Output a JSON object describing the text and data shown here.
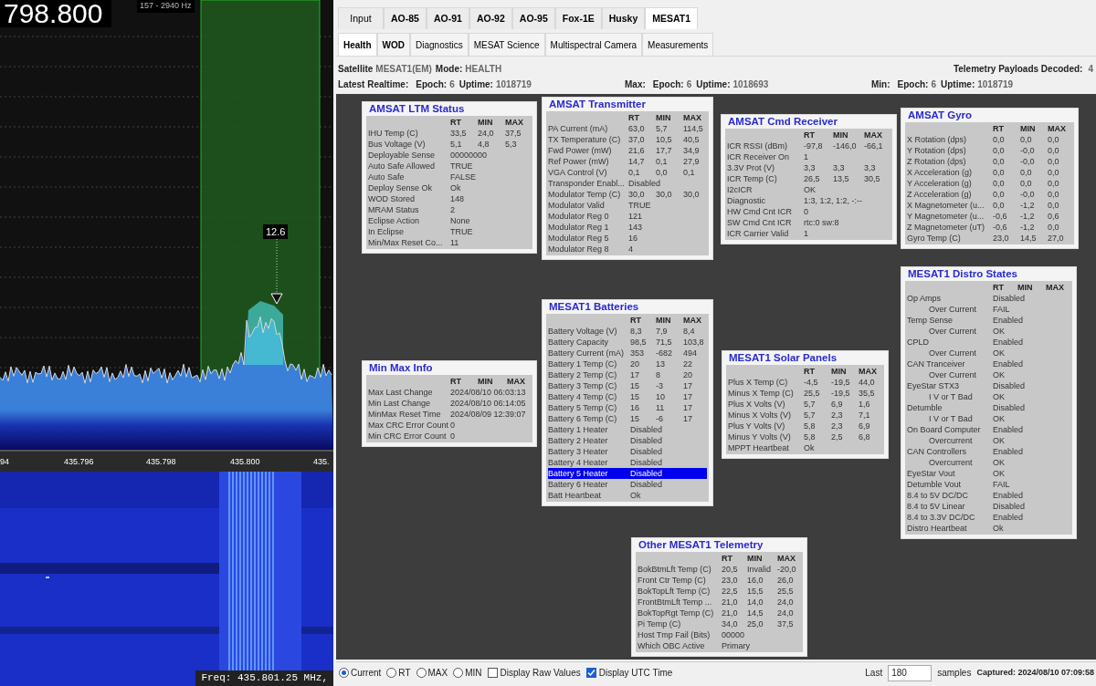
{
  "spectrum": {
    "frequency": "798.800",
    "bandwidth": "157 - 2940 Hz",
    "marker": "12.6",
    "axis_labels": [
      "94",
      "435.796",
      "435.798",
      "435.800",
      "435."
    ]
  },
  "waterfall": {
    "readout": "Freq: 435.801.25 MHz,"
  },
  "satellite_tabs": [
    {
      "label": "Input",
      "selected": false
    },
    {
      "label": "AO-85",
      "selected": false
    },
    {
      "label": "AO-91",
      "selected": false
    },
    {
      "label": "AO-92",
      "selected": false
    },
    {
      "label": "AO-95",
      "selected": false
    },
    {
      "label": "Fox-1E",
      "selected": false
    },
    {
      "label": "Husky",
      "selected": false
    },
    {
      "label": "MESAT1",
      "selected": true
    }
  ],
  "view_tabs": [
    {
      "label": "Health",
      "selected": true
    },
    {
      "label": "WOD",
      "selected": false
    },
    {
      "label": "Diagnostics",
      "selected": false
    },
    {
      "label": "MESAT Science",
      "selected": false
    },
    {
      "label": "Multispectral Camera",
      "selected": false
    },
    {
      "label": "Measurements",
      "selected": false
    }
  ],
  "info": {
    "satellite_label": "Satellite",
    "satellite": "MESAT1(EM)",
    "mode_label": "Mode:",
    "mode": "HEALTH",
    "payloads_label": "Telemetry Payloads Decoded:",
    "payloads": "4"
  },
  "epochs": [
    {
      "label": "Latest Realtime:",
      "epoch_label": "Epoch:",
      "epoch": "6",
      "uptime_label": "Uptime:",
      "uptime": "1018719"
    },
    {
      "label": "Max:",
      "epoch_label": "Epoch:",
      "epoch": "6",
      "uptime_label": "Uptime:",
      "uptime": "1018693"
    },
    {
      "label": "Min:",
      "epoch_label": "Epoch:",
      "epoch": "6",
      "uptime_label": "Uptime:",
      "uptime": "1018719"
    }
  ],
  "modules": [
    {
      "title": "AMSAT LTM Status",
      "headers": [
        "RT",
        "MIN",
        "MAX"
      ],
      "rows": [
        {
          "label": "IHU Temp (C)",
          "values": [
            "33,5",
            "24,0",
            "37,5"
          ],
          "selected": false
        },
        {
          "label": "Bus Voltage (V)",
          "values": [
            "5,1",
            "4,8",
            "5,3"
          ],
          "selected": false
        },
        {
          "label": "Deployable Sense",
          "values": [
            "00000000"
          ],
          "selected": false
        },
        {
          "label": "Auto Safe Allowed",
          "values": [
            "TRUE"
          ],
          "selected": false
        },
        {
          "label": "Auto Safe",
          "values": [
            "FALSE"
          ],
          "selected": false
        },
        {
          "label": "Deploy Sense Ok",
          "values": [
            "Ok"
          ],
          "selected": false
        },
        {
          "label": "WOD Stored",
          "values": [
            "148"
          ],
          "selected": false
        },
        {
          "label": "MRAM Status",
          "values": [
            "2"
          ],
          "selected": false
        },
        {
          "label": "Eclipse Action",
          "values": [
            "None"
          ],
          "selected": false
        },
        {
          "label": "In Eclipse",
          "values": [
            "TRUE"
          ],
          "selected": false
        },
        {
          "label": "Min/Max Reset Co...",
          "values": [
            "11"
          ],
          "selected": false
        }
      ]
    },
    {
      "title": "AMSAT Transmitter",
      "headers": [
        "RT",
        "MIN",
        "MAX"
      ],
      "rows": [
        {
          "label": "PA Current (mA)",
          "values": [
            "63,0",
            "5,7",
            "114,5"
          ],
          "selected": false
        },
        {
          "label": "TX Temperature (C)",
          "values": [
            "37,0",
            "10,5",
            "40,5"
          ],
          "selected": false
        },
        {
          "label": "Fwd Power (mW)",
          "values": [
            "21,6",
            "17,7",
            "34,9"
          ],
          "selected": false
        },
        {
          "label": "Ref Power (mW)",
          "values": [
            "14,7",
            "0,1",
            "27,9"
          ],
          "selected": false
        },
        {
          "label": "VGA Control (V)",
          "values": [
            "0,1",
            "0,0",
            "0,1"
          ],
          "selected": false
        },
        {
          "label": "Transponder Enabl...",
          "values": [
            "Disabled"
          ],
          "selected": false
        },
        {
          "label": "Modulator Temp (C)",
          "values": [
            "30,0",
            "30,0",
            "30,0"
          ],
          "selected": false
        },
        {
          "label": "Modulator Valid",
          "values": [
            "TRUE"
          ],
          "selected": false
        },
        {
          "label": "Modulator Reg 0",
          "values": [
            "121"
          ],
          "selected": false
        },
        {
          "label": "Modulator Reg 1",
          "values": [
            "143"
          ],
          "selected": false
        },
        {
          "label": "Modulator Reg 5",
          "values": [
            "16"
          ],
          "selected": false
        },
        {
          "label": "Modulator Reg 8",
          "values": [
            "4"
          ],
          "selected": false
        }
      ]
    },
    {
      "title": "AMSAT Cmd Receiver",
      "headers": [
        "RT",
        "MIN",
        "MAX"
      ],
      "rows": [
        {
          "label": "ICR RSSI (dBm)",
          "values": [
            "-97,8",
            "-146,0",
            "-66,1"
          ],
          "selected": false
        },
        {
          "label": "ICR Receiver On",
          "values": [
            "1"
          ],
          "selected": false
        },
        {
          "label": "3.3V Prot (V)",
          "values": [
            "3,3",
            "3,3",
            "3,3"
          ],
          "selected": false
        },
        {
          "label": "ICR Temp (C)",
          "values": [
            "26,5",
            "13,5",
            "30,5"
          ],
          "selected": false
        },
        {
          "label": "I2cICR",
          "values": [
            "OK"
          ],
          "selected": false
        },
        {
          "label": "Diagnostic",
          "values": [
            "1:3, 1:2, 1:2, -:--"
          ],
          "selected": false
        },
        {
          "label": "HW Cmd Cnt ICR",
          "values": [
            "0"
          ],
          "selected": false
        },
        {
          "label": "SW Cmd Cnt ICR",
          "values": [
            "rtc:0 sw:8"
          ],
          "selected": false
        },
        {
          "label": "ICR Carrier Valid",
          "values": [
            "1"
          ],
          "selected": false
        }
      ]
    },
    {
      "title": "AMSAT Gyro",
      "headers": [
        "RT",
        "MIN",
        "MAX"
      ],
      "rows": [
        {
          "label": "X Rotation (dps)",
          "values": [
            "0,0",
            "0,0",
            "0,0"
          ],
          "selected": false
        },
        {
          "label": "Y Rotation (dps)",
          "values": [
            "0,0",
            "-0,0",
            "0,0"
          ],
          "selected": false
        },
        {
          "label": "Z Rotation (dps)",
          "values": [
            "0,0",
            "-0,0",
            "0,0"
          ],
          "selected": false
        },
        {
          "label": "X Acceleration (g)",
          "values": [
            "0,0",
            "0,0",
            "0,0"
          ],
          "selected": false
        },
        {
          "label": "Y Acceleration (g)",
          "values": [
            "0,0",
            "0,0",
            "0,0"
          ],
          "selected": false
        },
        {
          "label": "Z Acceleration (g)",
          "values": [
            "0,0",
            "-0,0",
            "0,0"
          ],
          "selected": false
        },
        {
          "label": "X Magnetometer (u...",
          "values": [
            "0,0",
            "-1,2",
            "0,0"
          ],
          "selected": false
        },
        {
          "label": "Y Magnetometer (u...",
          "values": [
            "-0,6",
            "-1,2",
            "0,6"
          ],
          "selected": false
        },
        {
          "label": "Z Magnetometer (uT)",
          "values": [
            "-0,6",
            "-1,2",
            "0,0"
          ],
          "selected": false
        },
        {
          "label": "Gyro Temp (C)",
          "values": [
            "23,0",
            "14,5",
            "27,0"
          ],
          "selected": false
        }
      ]
    },
    {
      "title": "Min Max Info",
      "headers": [
        "RT",
        "MIN",
        "MAX"
      ],
      "rows": [
        {
          "label": "Max Last Change",
          "values": [
            "2024/08/10 06:03:13"
          ],
          "selected": false
        },
        {
          "label": "Min Last Change",
          "values": [
            "2024/08/10 06:14:05"
          ],
          "selected": false
        },
        {
          "label": "MinMax Reset Time",
          "values": [
            "2024/08/09 12:39:07"
          ],
          "selected": false
        },
        {
          "label": "Max CRC Error Count",
          "values": [
            "0"
          ],
          "selected": false
        },
        {
          "label": "Min CRC Error Count",
          "values": [
            "0"
          ],
          "selected": false
        }
      ]
    },
    {
      "title": "MESAT1 Batteries",
      "headers": [
        "RT",
        "MIN",
        "MAX"
      ],
      "rows": [
        {
          "label": "Battery Voltage (V)",
          "values": [
            "8,3",
            "7,9",
            "8,4"
          ],
          "selected": false
        },
        {
          "label": "Battery Capacity",
          "values": [
            "98,5",
            "71,5",
            "103,8"
          ],
          "selected": false
        },
        {
          "label": "Battery Current (mA)",
          "values": [
            "353",
            "-682",
            "494"
          ],
          "selected": false
        },
        {
          "label": "Battery 1 Temp (C)",
          "values": [
            "20",
            "13",
            "22"
          ],
          "selected": false
        },
        {
          "label": "Battery 2 Temp (C)",
          "values": [
            "17",
            "8",
            "20"
          ],
          "selected": false
        },
        {
          "label": "Battery 3 Temp (C)",
          "values": [
            "15",
            "-3",
            "17"
          ],
          "selected": false
        },
        {
          "label": "Battery 4 Temp (C)",
          "values": [
            "15",
            "10",
            "17"
          ],
          "selected": false
        },
        {
          "label": "Battery 5 Temp (C)",
          "values": [
            "16",
            "11",
            "17"
          ],
          "selected": false
        },
        {
          "label": "Battery 6 Temp (C)",
          "values": [
            "15",
            "-6",
            "17"
          ],
          "selected": false
        },
        {
          "label": "Battery 1 Heater",
          "values": [
            "Disabled"
          ],
          "selected": false
        },
        {
          "label": "Battery 2 Heater",
          "values": [
            "Disabled"
          ],
          "selected": false
        },
        {
          "label": "Battery 3 Heater",
          "values": [
            "Disabled"
          ],
          "selected": false
        },
        {
          "label": "Battery 4 Heater",
          "values": [
            "Disabled"
          ],
          "selected": false
        },
        {
          "label": "Battery 5 Heater",
          "values": [
            "Disabled"
          ],
          "selected": true
        },
        {
          "label": "Battery 6 Heater",
          "values": [
            "Disabled"
          ],
          "selected": false
        },
        {
          "label": "Batt Heartbeat",
          "values": [
            "Ok"
          ],
          "selected": false
        }
      ]
    },
    {
      "title": "MESAT1 Solar Panels",
      "headers": [
        "RT",
        "MIN",
        "MAX"
      ],
      "rows": [
        {
          "label": "Plus X Temp (C)",
          "values": [
            "-4,5",
            "-19,5",
            "44,0"
          ],
          "selected": false
        },
        {
          "label": "Minus X Temp (C)",
          "values": [
            "25,5",
            "-19,5",
            "35,5"
          ],
          "selected": false
        },
        {
          "label": "Plus X Volts (V)",
          "values": [
            "5,7",
            "6,9",
            "1,6"
          ],
          "selected": false
        },
        {
          "label": "Minus X Volts (V)",
          "values": [
            "5,7",
            "2,3",
            "7,1"
          ],
          "selected": false
        },
        {
          "label": "Plus Y Volts (V)",
          "values": [
            "5,8",
            "2,3",
            "6,9"
          ],
          "selected": false
        },
        {
          "label": "Minus Y Volts (V)",
          "values": [
            "5,8",
            "2,5",
            "6,8"
          ],
          "selected": false
        },
        {
          "label": "MPPT Heartbeat",
          "values": [
            "Ok"
          ],
          "selected": false
        }
      ]
    },
    {
      "title": "MESAT1 Distro States",
      "headers": [
        "RT",
        "MIN",
        "MAX"
      ],
      "rows": [
        {
          "label": "Op Amps",
          "values": [
            "Disabled"
          ],
          "selected": false,
          "children": [
            {
              "label": "Over Current",
              "values": [
                "FAIL"
              ],
              "selected": false
            }
          ]
        },
        {
          "label": "Temp Sense",
          "values": [
            "Enabled"
          ],
          "selected": false,
          "children": [
            {
              "label": "Over Current",
              "values": [
                "OK"
              ],
              "selected": false
            }
          ]
        },
        {
          "label": "CPLD",
          "values": [
            "Enabled"
          ],
          "selected": false,
          "children": [
            {
              "label": "Over Current",
              "values": [
                "OK"
              ],
              "selected": false
            }
          ]
        },
        {
          "label": "CAN Tranceiver",
          "values": [
            "Enabled"
          ],
          "selected": false,
          "children": [
            {
              "label": "Over Current",
              "values": [
                "OK"
              ],
              "selected": false
            }
          ]
        },
        {
          "label": "EyeStar STX3",
          "values": [
            "Disabled"
          ],
          "selected": false,
          "children": [
            {
              "label": "I V or T Bad",
              "values": [
                "OK"
              ],
              "selected": false
            }
          ]
        },
        {
          "label": "Detumble",
          "values": [
            "Disabled"
          ],
          "selected": false,
          "children": [
            {
              "label": "I V or T Bad",
              "values": [
                "OK"
              ],
              "selected": false
            }
          ]
        },
        {
          "label": "On Board Computer",
          "values": [
            "Enabled"
          ],
          "selected": false,
          "children": [
            {
              "label": "Overcurrent",
              "values": [
                "OK"
              ],
              "selected": false
            }
          ]
        },
        {
          "label": "CAN Controllers",
          "values": [
            "Enabled"
          ],
          "selected": false,
          "children": [
            {
              "label": "Overcurrent",
              "values": [
                "OK"
              ],
              "selected": false
            }
          ]
        },
        {
          "label": "EyeStar Vout",
          "values": [
            "OK"
          ],
          "selected": false
        },
        {
          "label": "Detumble Vout",
          "values": [
            "FAIL"
          ],
          "selected": false
        },
        {
          "label": "8.4 to 5V DC/DC",
          "values": [
            "Enabled"
          ],
          "selected": false
        },
        {
          "label": "8.4 to 5V Linear",
          "values": [
            "Disabled"
          ],
          "selected": false
        },
        {
          "label": "8.4 to 3.3V DC/DC",
          "values": [
            "Enabled"
          ],
          "selected": false
        },
        {
          "label": "Distro Heartbeat",
          "values": [
            "Ok"
          ],
          "selected": false
        }
      ]
    },
    {
      "title": "Other MESAT1 Telemetry",
      "headers": [
        "RT",
        "MIN",
        "MAX"
      ],
      "rows": [
        {
          "label": "BokBtmLft Temp (C)",
          "values": [
            "20,5",
            "Invalid",
            "-20,0"
          ],
          "selected": false
        },
        {
          "label": "Front Ctr Temp (C)",
          "values": [
            "23,0",
            "16,0",
            "26,0"
          ],
          "selected": false
        },
        {
          "label": "BokTopLft Temp (C)",
          "values": [
            "22,5",
            "15,5",
            "25,5"
          ],
          "selected": false
        },
        {
          "label": "FrontBtmLft Temp ...",
          "values": [
            "21,0",
            "14,0",
            "24,0"
          ],
          "selected": false
        },
        {
          "label": "BokTopRgt Temp (C)",
          "values": [
            "21,0",
            "14,5",
            "24,0"
          ],
          "selected": false
        },
        {
          "label": "Pi Temp (C)",
          "values": [
            "34,0",
            "25,0",
            "37,5"
          ],
          "selected": false
        },
        {
          "label": "Host Tmp Fail (Bits)",
          "values": [
            "00000"
          ],
          "selected": false
        },
        {
          "label": "Which OBC Active",
          "values": [
            "Primary"
          ],
          "selected": false
        }
      ]
    }
  ],
  "display_modes": [
    {
      "label": "Current",
      "selected": true
    },
    {
      "label": "RT",
      "selected": false
    },
    {
      "label": "MAX",
      "selected": false
    },
    {
      "label": "MIN",
      "selected": false
    }
  ],
  "options": [
    {
      "label": "Display Raw Values",
      "checked": false
    },
    {
      "label": "Display UTC Time",
      "checked": true
    }
  ],
  "samples": {
    "label": "Last",
    "value": "180",
    "unit": "samples"
  },
  "captured": "Captured: 2024/08/10 07:09:58"
}
